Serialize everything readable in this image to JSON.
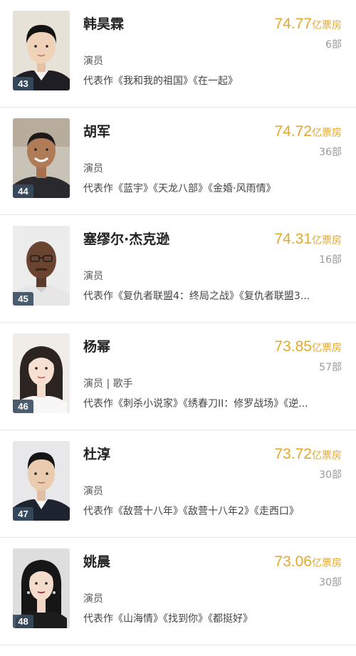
{
  "accent_color": "#e3a82b",
  "actors": [
    {
      "rank": "43",
      "name": "韩昊霖",
      "box_office": "74.77",
      "unit": "亿票房",
      "films": "6部",
      "role": "演员",
      "works": "代表作《我和我的祖国》《在一起》",
      "photo_icon": "actor-photo-boy"
    },
    {
      "rank": "44",
      "name": "胡军",
      "box_office": "74.72",
      "unit": "亿票房",
      "films": "36部",
      "role": "演员",
      "works": "代表作《蓝宇》《天龙八部》《金婚·风雨情》",
      "photo_icon": "actor-photo-man"
    },
    {
      "rank": "45",
      "name": "塞缪尔·杰克逊",
      "box_office": "74.31",
      "unit": "亿票房",
      "films": "16部",
      "role": "演员",
      "works": "代表作《复仇者联盟4：终局之战》《复仇者联盟3...",
      "photo_icon": "actor-photo-man-glasses"
    },
    {
      "rank": "46",
      "name": "杨幂",
      "box_office": "73.85",
      "unit": "亿票房",
      "films": "57部",
      "role": "演员 | 歌手",
      "works": "代表作《刺杀小说家》《绣春刀II：修罗战场》《逆...",
      "photo_icon": "actor-photo-woman"
    },
    {
      "rank": "47",
      "name": "杜淳",
      "box_office": "73.72",
      "unit": "亿票房",
      "films": "30部",
      "role": "演员",
      "works": "代表作《敌营十八年》《敌营十八年2》《走西口》",
      "photo_icon": "actor-photo-man-suit"
    },
    {
      "rank": "48",
      "name": "姚晨",
      "box_office": "73.06",
      "unit": "亿票房",
      "films": "30部",
      "role": "演员",
      "works": "代表作《山海情》《找到你》《都挺好》",
      "photo_icon": "actor-photo-woman-dark"
    }
  ]
}
